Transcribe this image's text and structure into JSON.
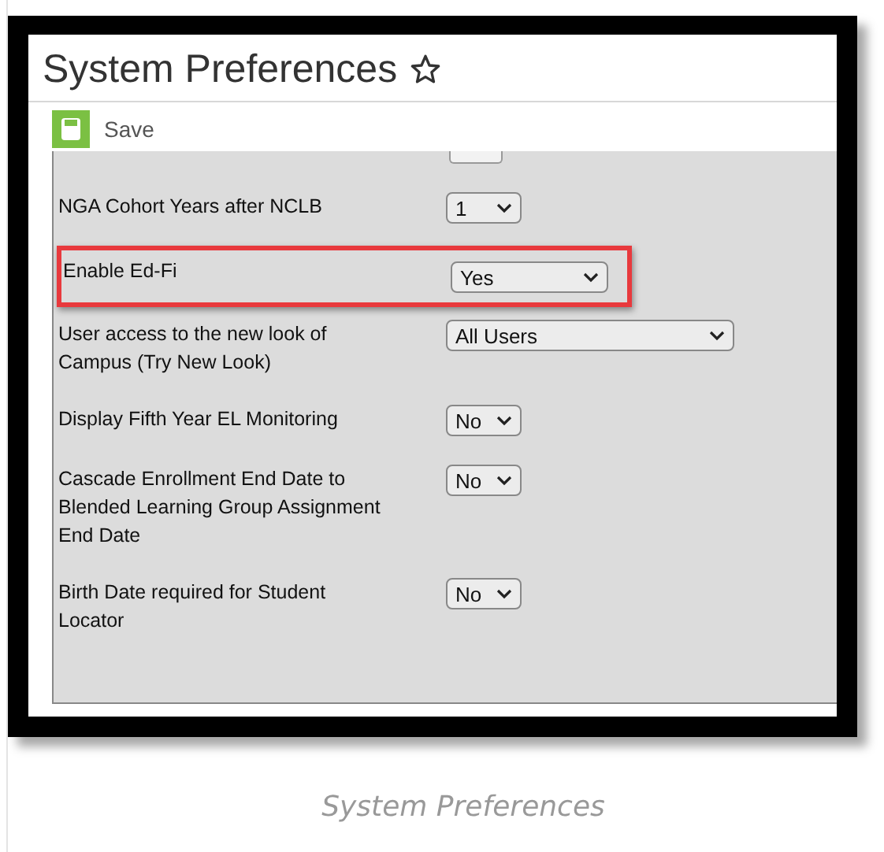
{
  "page": {
    "title": "System Preferences",
    "favorite": false
  },
  "toolbar": {
    "save_label": "Save"
  },
  "preferences": [
    {
      "label": "NGA Cohort Years after NCLB",
      "value": "1",
      "kind": "narrow",
      "highlighted": false
    },
    {
      "label": "Enable Ed-Fi",
      "value": "Yes",
      "kind": "medium",
      "highlighted": true
    },
    {
      "label": "User access to the new look of Campus (Try New Look)",
      "value": "All Users",
      "kind": "wide",
      "highlighted": false
    },
    {
      "label": "Display Fifth Year EL Monitoring",
      "value": "No",
      "kind": "narrow",
      "highlighted": false
    },
    {
      "label": "Cascade Enrollment End Date to Blended Learning Group Assignment End Date",
      "value": "No",
      "kind": "narrow",
      "highlighted": false
    },
    {
      "label": "Birth Date required for Student Locator",
      "value": "No",
      "kind": "narrow",
      "highlighted": false
    }
  ],
  "caption": "System Preferences"
}
